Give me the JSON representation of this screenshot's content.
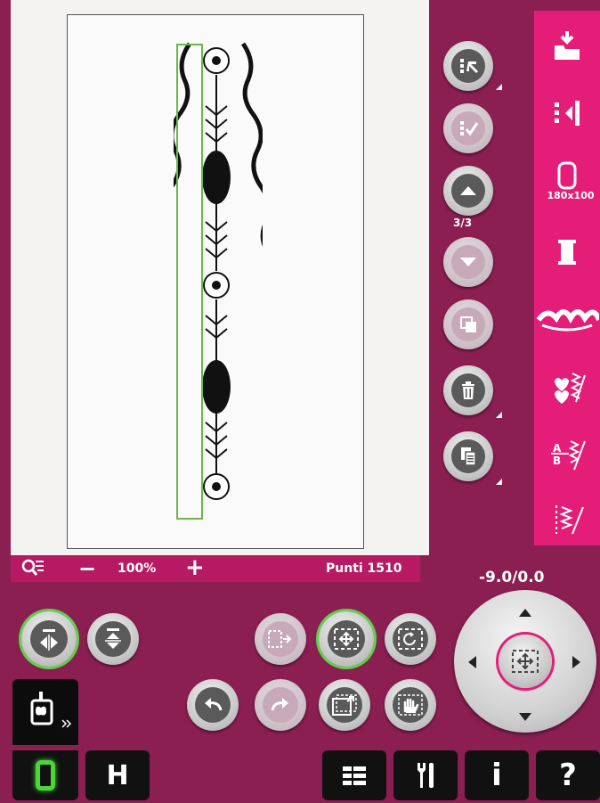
{
  "zoom": {
    "value": "100%",
    "minus": "−",
    "plus": "+"
  },
  "stitch_count": "Punti 1510",
  "page_indicator": "3/3",
  "position_readout": "-9.0/0.0",
  "hoop_size": "180x100",
  "sidebar": {
    "items": [
      {
        "icon": "load-design-icon"
      },
      {
        "icon": "align-edge-icon"
      },
      {
        "icon": "hoop-icon",
        "label": "180x100"
      },
      {
        "icon": "thread-spool-icon"
      },
      {
        "icon": "border-design-icon"
      },
      {
        "icon": "heart-stitch-icon"
      },
      {
        "icon": "font-stitch-icon"
      },
      {
        "icon": "zigzag-stitch-icon"
      }
    ]
  },
  "bottom_bar": {
    "items": [
      "0",
      "H",
      "list",
      "tools",
      "i",
      "?"
    ]
  },
  "colors": {
    "accent": "#e41e78",
    "background": "#8c1f52",
    "selection": "#6ab84a"
  }
}
